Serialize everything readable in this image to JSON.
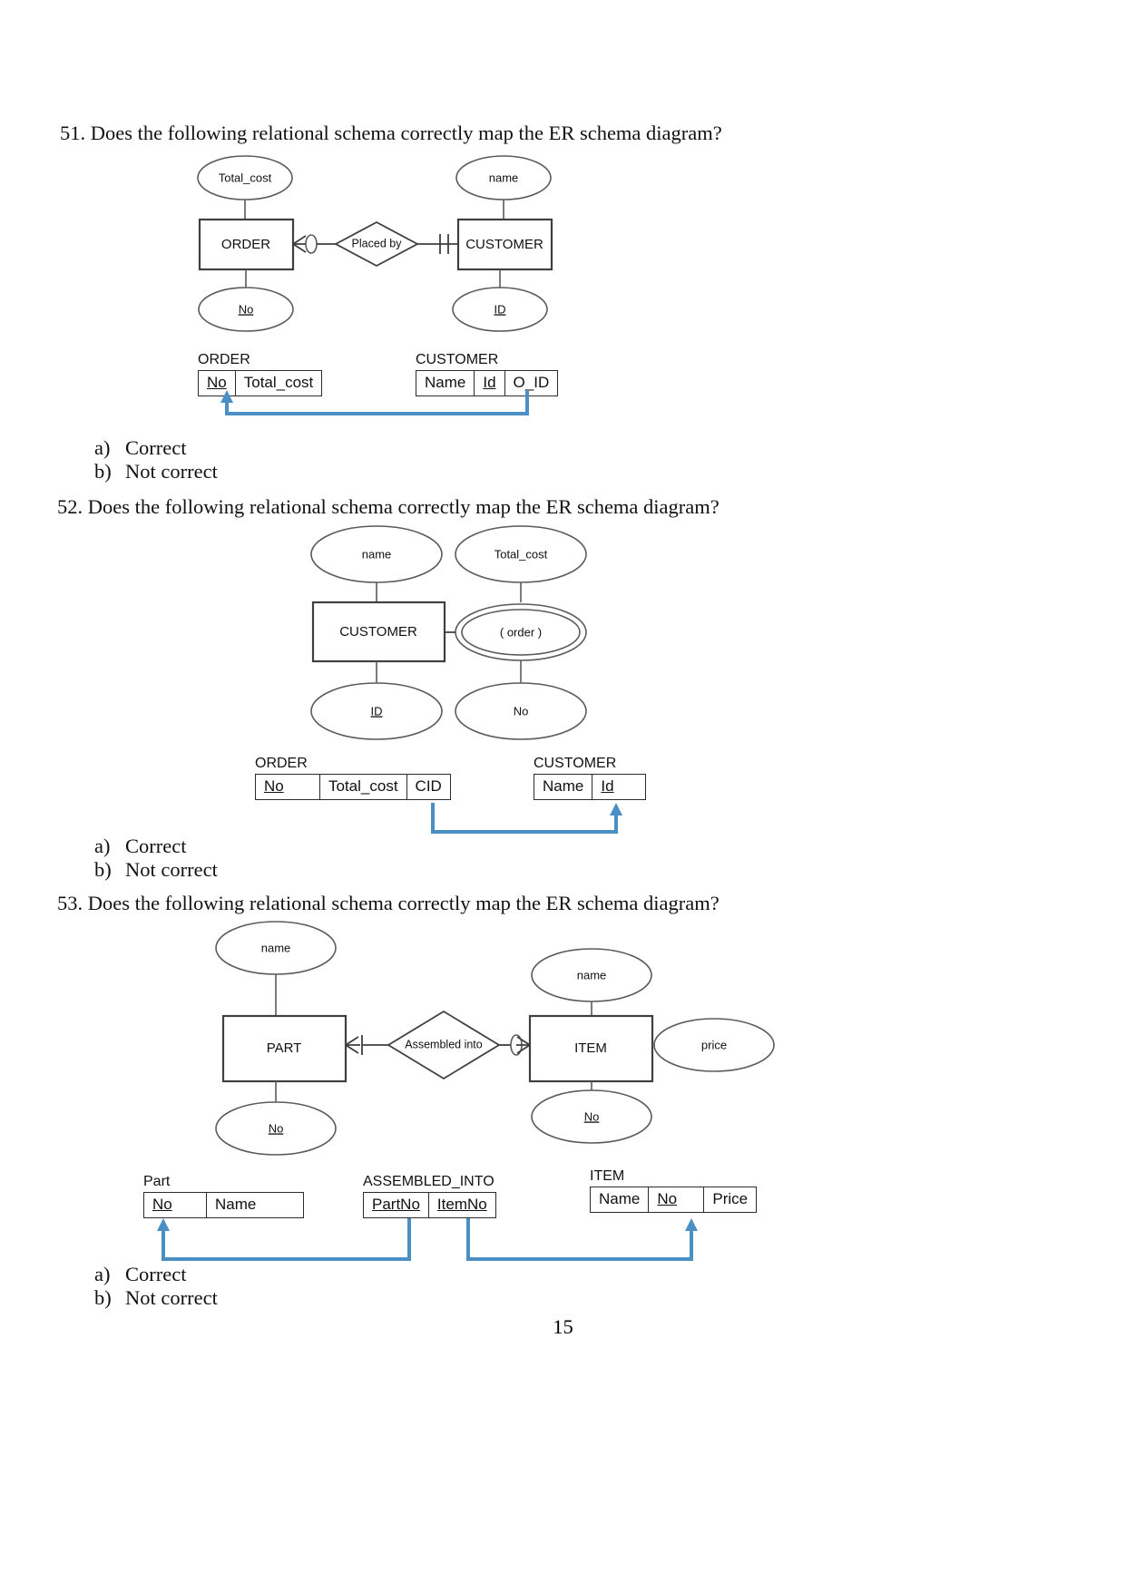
{
  "page": {
    "number": "15"
  },
  "questions": [
    {
      "number": "51.",
      "prompt": "51. Does the following relational schema correctly map the ER schema diagram?",
      "options": [
        {
          "letter": "a)",
          "text": "Correct"
        },
        {
          "letter": "b)",
          "text": "Not correct"
        }
      ],
      "er": {
        "entities": [
          {
            "label": "ORDER"
          },
          {
            "label": "CUSTOMER"
          }
        ],
        "relationship": {
          "label": "Placed by"
        },
        "attributes": [
          {
            "label": "Total_cost",
            "key": false
          },
          {
            "label": "name",
            "key": false
          },
          {
            "label": "No",
            "key": true
          },
          {
            "label": "ID",
            "key": true
          }
        ]
      },
      "tables": [
        {
          "name": "ORDER",
          "columns": [
            {
              "label": "No",
              "pk": true
            },
            {
              "label": "Total_cost",
              "pk": false
            }
          ]
        },
        {
          "name": "CUSTOMER",
          "columns": [
            {
              "label": "Name",
              "pk": false
            },
            {
              "label": "Id",
              "pk": true
            },
            {
              "label": "O_ID",
              "pk": false
            }
          ]
        }
      ]
    },
    {
      "number": "52.",
      "prompt": "52. Does the following relational schema correctly map the ER schema diagram?",
      "options": [
        {
          "letter": "a)",
          "text": "Correct"
        },
        {
          "letter": "b)",
          "text": "Not correct"
        }
      ],
      "er": {
        "entities": [
          {
            "label": "CUSTOMER"
          }
        ],
        "multivalued": {
          "label": "( order )"
        },
        "attributes": [
          {
            "label": "name",
            "key": false
          },
          {
            "label": "Total_cost",
            "key": false
          },
          {
            "label": "ID",
            "key": true
          },
          {
            "label": "No",
            "key": false
          }
        ]
      },
      "tables": [
        {
          "name": "ORDER",
          "columns": [
            {
              "label": "No",
              "pk": true
            },
            {
              "label": "Total_cost",
              "pk": false
            },
            {
              "label": "CID",
              "pk": false
            }
          ]
        },
        {
          "name": "CUSTOMER",
          "columns": [
            {
              "label": "Name",
              "pk": false
            },
            {
              "label": "Id",
              "pk": true
            }
          ]
        }
      ]
    },
    {
      "number": "53.",
      "prompt": "53. Does the following relational schema correctly map the ER schema diagram?",
      "options": [
        {
          "letter": "a)",
          "text": "Correct"
        },
        {
          "letter": "b)",
          "text": "Not correct"
        }
      ],
      "er": {
        "entities": [
          {
            "label": "PART"
          },
          {
            "label": "ITEM"
          }
        ],
        "relationship": {
          "label": "Assembled into"
        },
        "attributes": [
          {
            "label": "name",
            "key": false
          },
          {
            "label": "name",
            "key": false
          },
          {
            "label": "price",
            "key": false
          },
          {
            "label": "No",
            "key": true
          },
          {
            "label": "No",
            "key": true
          }
        ]
      },
      "tables": [
        {
          "name": "Part",
          "columns": [
            {
              "label": "No",
              "pk": true
            },
            {
              "label": "Name",
              "pk": false
            }
          ]
        },
        {
          "name": "ASSEMBLED_INTO",
          "columns": [
            {
              "label": "PartNo",
              "pk": true
            },
            {
              "label": "ItemNo",
              "pk": true
            }
          ]
        },
        {
          "name": "ITEM",
          "columns": [
            {
              "label": "Name",
              "pk": false
            },
            {
              "label": "No",
              "pk": true
            },
            {
              "label": "Price",
              "pk": false
            }
          ]
        }
      ]
    }
  ],
  "colors": {
    "arrow": "#4a90c4",
    "ink": "#111111",
    "line": "#3f3f3f"
  }
}
